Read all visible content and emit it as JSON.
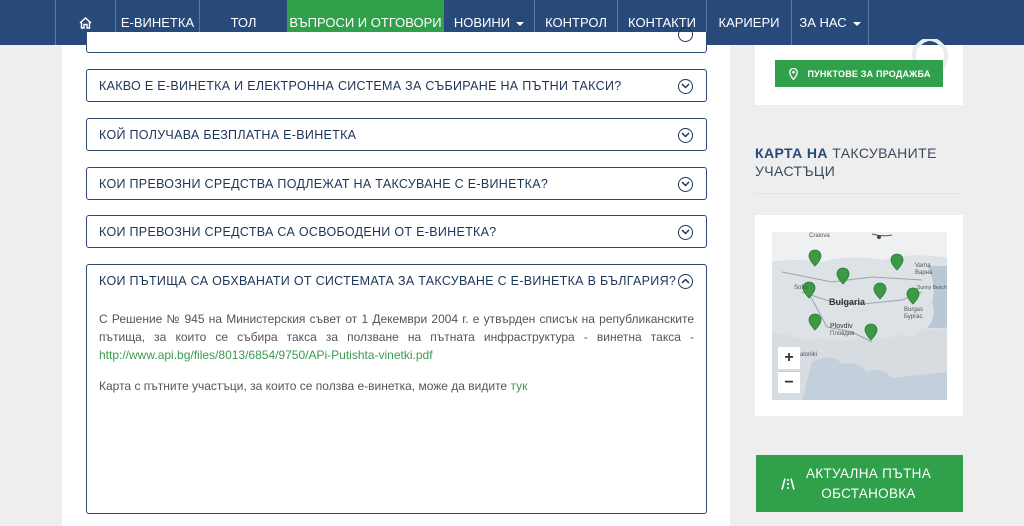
{
  "nav": {
    "items": [
      {
        "label": "Е-ВИНЕТКА"
      },
      {
        "label": "ТОЛ"
      },
      {
        "label": "ВЪПРОСИ И ОТГОВОРИ"
      },
      {
        "label": "НОВИНИ"
      },
      {
        "label": "КОНТРОЛ"
      },
      {
        "label": "КОНТАКТИ"
      },
      {
        "label": "КАРИЕРИ"
      },
      {
        "label": "ЗА НАС"
      }
    ]
  },
  "faq": [
    {
      "question": "КАКВО Е Е-ВИНЕТКА И ЕЛЕКТРОННА СИСТЕМА ЗА СЪБИРАНЕ НА ПЪТНИ ТАКСИ?"
    },
    {
      "question": "КОЙ ПОЛУЧАВА БЕЗПЛАТНА Е-ВИНЕТКА"
    },
    {
      "question": "КОИ ПРЕВОЗНИ СРЕДСТВА ПОДЛЕЖАТ НА ТАКСУВАНЕ С Е-ВИНЕТКА?"
    },
    {
      "question": "КОИ ПРЕВОЗНИ СРЕДСТВА СА ОСВОБОДЕНИ ОТ Е-ВИНЕТКА?"
    },
    {
      "question": "КОИ ПЪТИЩА СА ОБХВАНАТИ ОТ СИСТЕМАТА ЗА ТАКСУВАНЕ С Е-ВИНЕТКА В БЪЛГАРИЯ?"
    }
  ],
  "answer": {
    "text1": "С Решение № 945 на Министерския съвет от 1 Декември 2004 г. е утвърден списък на републиканските пътища, за които се събира такса за ползване на пътната инфраструктура - винетна такса - ",
    "link1": "http://www.api.bg/files/8013/6854/9750/APi-Putishta-vinetki.pdf",
    "text2": "Карта с пътните участъци, за които се ползва е-винетка, може да видите ",
    "link2": "тук"
  },
  "sidebar": {
    "sales_button": "ПУНКТОВЕ ЗА ПРОДАЖБА",
    "map_title_bold": "КАРТА НА",
    "map_title_rest": "ТАКСУВАНИТЕ УЧАСТЪЦИ",
    "road_button": "АКТУАЛНА ПЪТНА ОБСТАНОВКА"
  },
  "map": {
    "labels": {
      "craiova": "Craiova",
      "varna_en": "Varna",
      "varna_bg": "Варна",
      "sofia": "Sofia",
      "bulgaria": "Bulgaria",
      "sunny_beach": "Sunny Beach",
      "burgas_en": "Burgas",
      "burgas_bg": "Бургас",
      "plovdiv_en": "Plovdiv",
      "plovdiv_bg": "Пловдив",
      "thessaloniki": "aloniki"
    },
    "zoom_in": "+",
    "zoom_out": "−"
  },
  "colors": {
    "nav_bg": "#284a7b",
    "accent_green": "#30a04a",
    "border_dark": "#2d4a73"
  },
  "icons": {
    "home": "home-icon",
    "chevron_down": "chevron-down-circle-icon",
    "chevron_up": "chevron-up-circle-icon",
    "pin": "location-pin-icon",
    "road": "road-icon"
  }
}
